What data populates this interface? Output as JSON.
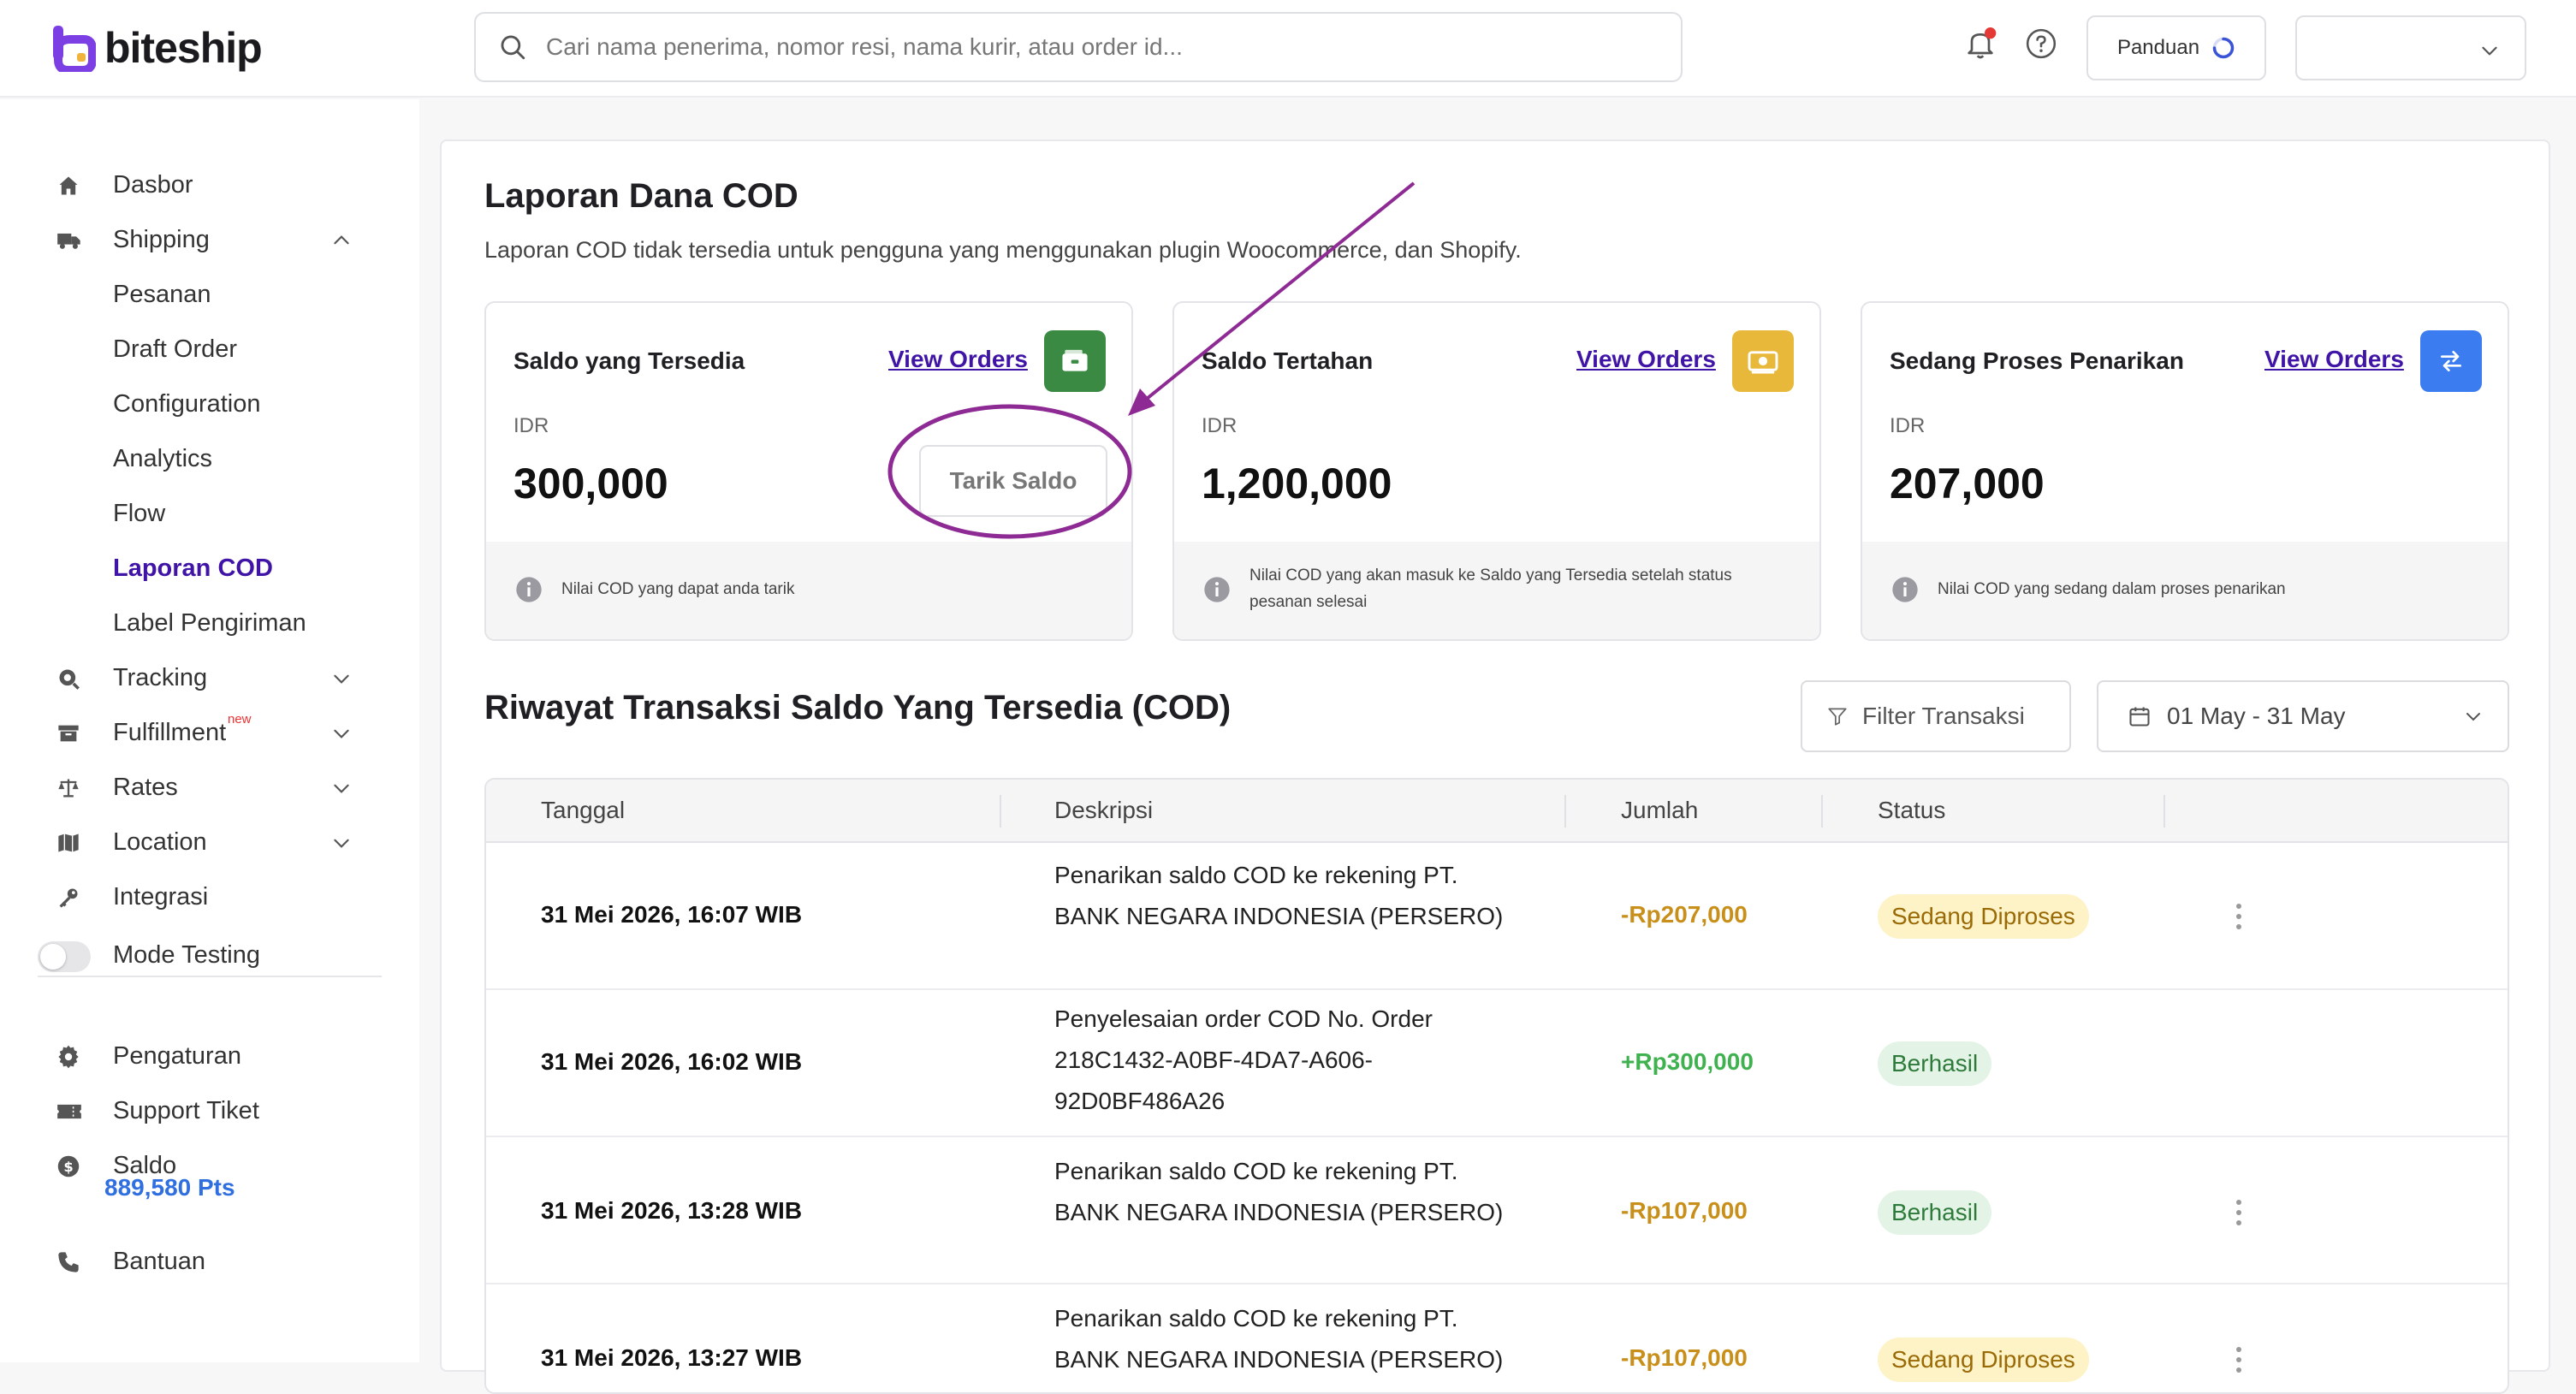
{
  "brand": {
    "name": "biteship"
  },
  "search": {
    "placeholder": "Cari nama penerima, nomor resi, nama kurir, atau order id..."
  },
  "topbar": {
    "guide_label": "Panduan"
  },
  "sidebar": {
    "dasbor": "Dasbor",
    "shipping": "Shipping",
    "pesanan": "Pesanan",
    "draft_order": "Draft Order",
    "configuration": "Configuration",
    "analytics": "Analytics",
    "flow": "Flow",
    "laporan_cod": "Laporan COD",
    "label_pengiriman": "Label Pengiriman",
    "tracking": "Tracking",
    "fulfillment": "Fulfillment",
    "fulfillment_badge": "new",
    "rates": "Rates",
    "location": "Location",
    "integrasi": "Integrasi",
    "mode_testing": "Mode Testing",
    "pengaturan": "Pengaturan",
    "support_tiket": "Support Tiket",
    "saldo": "Saldo",
    "points": "889,580 Pts",
    "bantuan": "Bantuan"
  },
  "page": {
    "title": "Laporan Dana COD",
    "subtitle": "Laporan COD tidak tersedia untuk pengguna yang menggunakan plugin Woocommerce, dan Shopify."
  },
  "cards": [
    {
      "title": "Saldo yang Tersedia",
      "link": "View Orders",
      "currency": "IDR",
      "amount": "300,000",
      "footer": "Nilai COD yang dapat anda tarik",
      "action": "Tarik Saldo",
      "icon_color": "#3a8a44"
    },
    {
      "title": "Saldo Tertahan",
      "link": "View Orders",
      "currency": "IDR",
      "amount": "1,200,000",
      "footer_line1": "Nilai COD yang akan masuk ke Saldo yang Tersedia setelah status",
      "footer_line2": "pesanan selesai",
      "icon_color": "#e8b83a"
    },
    {
      "title": "Sedang Proses Penarikan",
      "link": "View Orders",
      "currency": "IDR",
      "amount": "207,000",
      "footer": "Nilai COD yang sedang dalam proses penarikan",
      "icon_color": "#3b7cf0"
    }
  ],
  "history": {
    "title": "Riwayat Transaksi Saldo Yang Tersedia (COD)",
    "filter_label": "Filter Transaksi",
    "date_range": "01 May - 31 May",
    "columns": [
      "Tanggal",
      "Deskripsi",
      "Jumlah",
      "Status"
    ],
    "rows": [
      {
        "date": "31 Mei 2026, 16:07 WIB",
        "desc_lines": [
          "Penarikan saldo COD ke rekening PT.",
          "BANK NEGARA INDONESIA (PERSERO)"
        ],
        "amount": "-Rp207,000",
        "status": "Sedang Diproses"
      },
      {
        "date": "31 Mei 2026, 16:02 WIB",
        "desc_lines": [
          "Penyelesaian order COD No. Order",
          "218C1432-A0BF-4DA7-A606-",
          "92D0BF486A26"
        ],
        "amount": "+Rp300,000",
        "status": "Berhasil"
      },
      {
        "date": "31 Mei 2026, 13:28 WIB",
        "desc_lines": [
          "Penarikan saldo COD ke rekening PT.",
          "BANK NEGARA INDONESIA (PERSERO)"
        ],
        "amount": "-Rp107,000",
        "status": "Berhasil"
      },
      {
        "date": "31 Mei 2026, 13:27 WIB",
        "desc_lines": [
          "Penarikan saldo COD ke rekening PT.",
          "BANK NEGARA INDONESIA (PERSERO)"
        ],
        "amount": "-Rp107,000",
        "status": "Sedang Diproses"
      }
    ]
  },
  "colors": {
    "accent": "#3f14a6",
    "negative_amount": "#c8901a",
    "positive_amount": "#3fb24f",
    "annotation": "#8e2a93"
  }
}
